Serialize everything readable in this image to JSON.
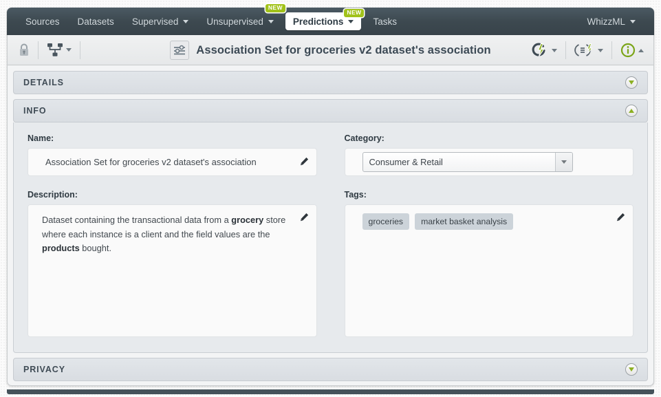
{
  "nav": {
    "items": [
      {
        "label": "Sources",
        "has_caret": false,
        "badge": "",
        "active": false
      },
      {
        "label": "Datasets",
        "has_caret": false,
        "badge": "",
        "active": false
      },
      {
        "label": "Supervised",
        "has_caret": true,
        "badge": "",
        "active": false
      },
      {
        "label": "Unsupervised",
        "has_caret": true,
        "badge": "NEW",
        "active": false
      },
      {
        "label": "Predictions",
        "has_caret": true,
        "badge": "NEW",
        "active": true
      },
      {
        "label": "Tasks",
        "has_caret": false,
        "badge": "",
        "active": false
      }
    ],
    "account": {
      "label": "WhizzML"
    },
    "badge_text": "NEW"
  },
  "titlebar": {
    "lock_icon": "lock-icon",
    "resource_menu_icon": "sitemap-icon",
    "resource_icon": "sliders-icon",
    "title": "Association Set for groceries v2 dataset's association",
    "actions": [
      {
        "name": "retrain-icon",
        "label": ""
      },
      {
        "name": "script-icon",
        "label": ""
      },
      {
        "name": "info-icon",
        "label": ""
      }
    ]
  },
  "sections": {
    "details": {
      "title": "DETAILS",
      "expanded": false
    },
    "info": {
      "title": "INFO",
      "expanded": true
    },
    "privacy": {
      "title": "PRIVACY",
      "expanded": false
    }
  },
  "info": {
    "name": {
      "label": "Name:",
      "value": "Association Set for groceries v2 dataset's association"
    },
    "description": {
      "label": "Description:",
      "parts": [
        {
          "text": "Dataset containing the transactional data from a ",
          "bold": false
        },
        {
          "text": "grocery",
          "bold": true
        },
        {
          "text": " store where each instance is a client and the field values are the ",
          "bold": false
        },
        {
          "text": "products",
          "bold": true
        },
        {
          "text": " bought.",
          "bold": false
        }
      ]
    },
    "category": {
      "label": "Category:",
      "value": "Consumer & Retail"
    },
    "tags": {
      "label": "Tags:",
      "items": [
        "groceries",
        "market basket analysis"
      ]
    }
  },
  "colors": {
    "nav_bg": "#3d4950",
    "accent_green": "#a1c21a",
    "toggle_green": "#8cb023",
    "panel_bg": "#e7eaed",
    "title_text": "#3c4a55"
  }
}
